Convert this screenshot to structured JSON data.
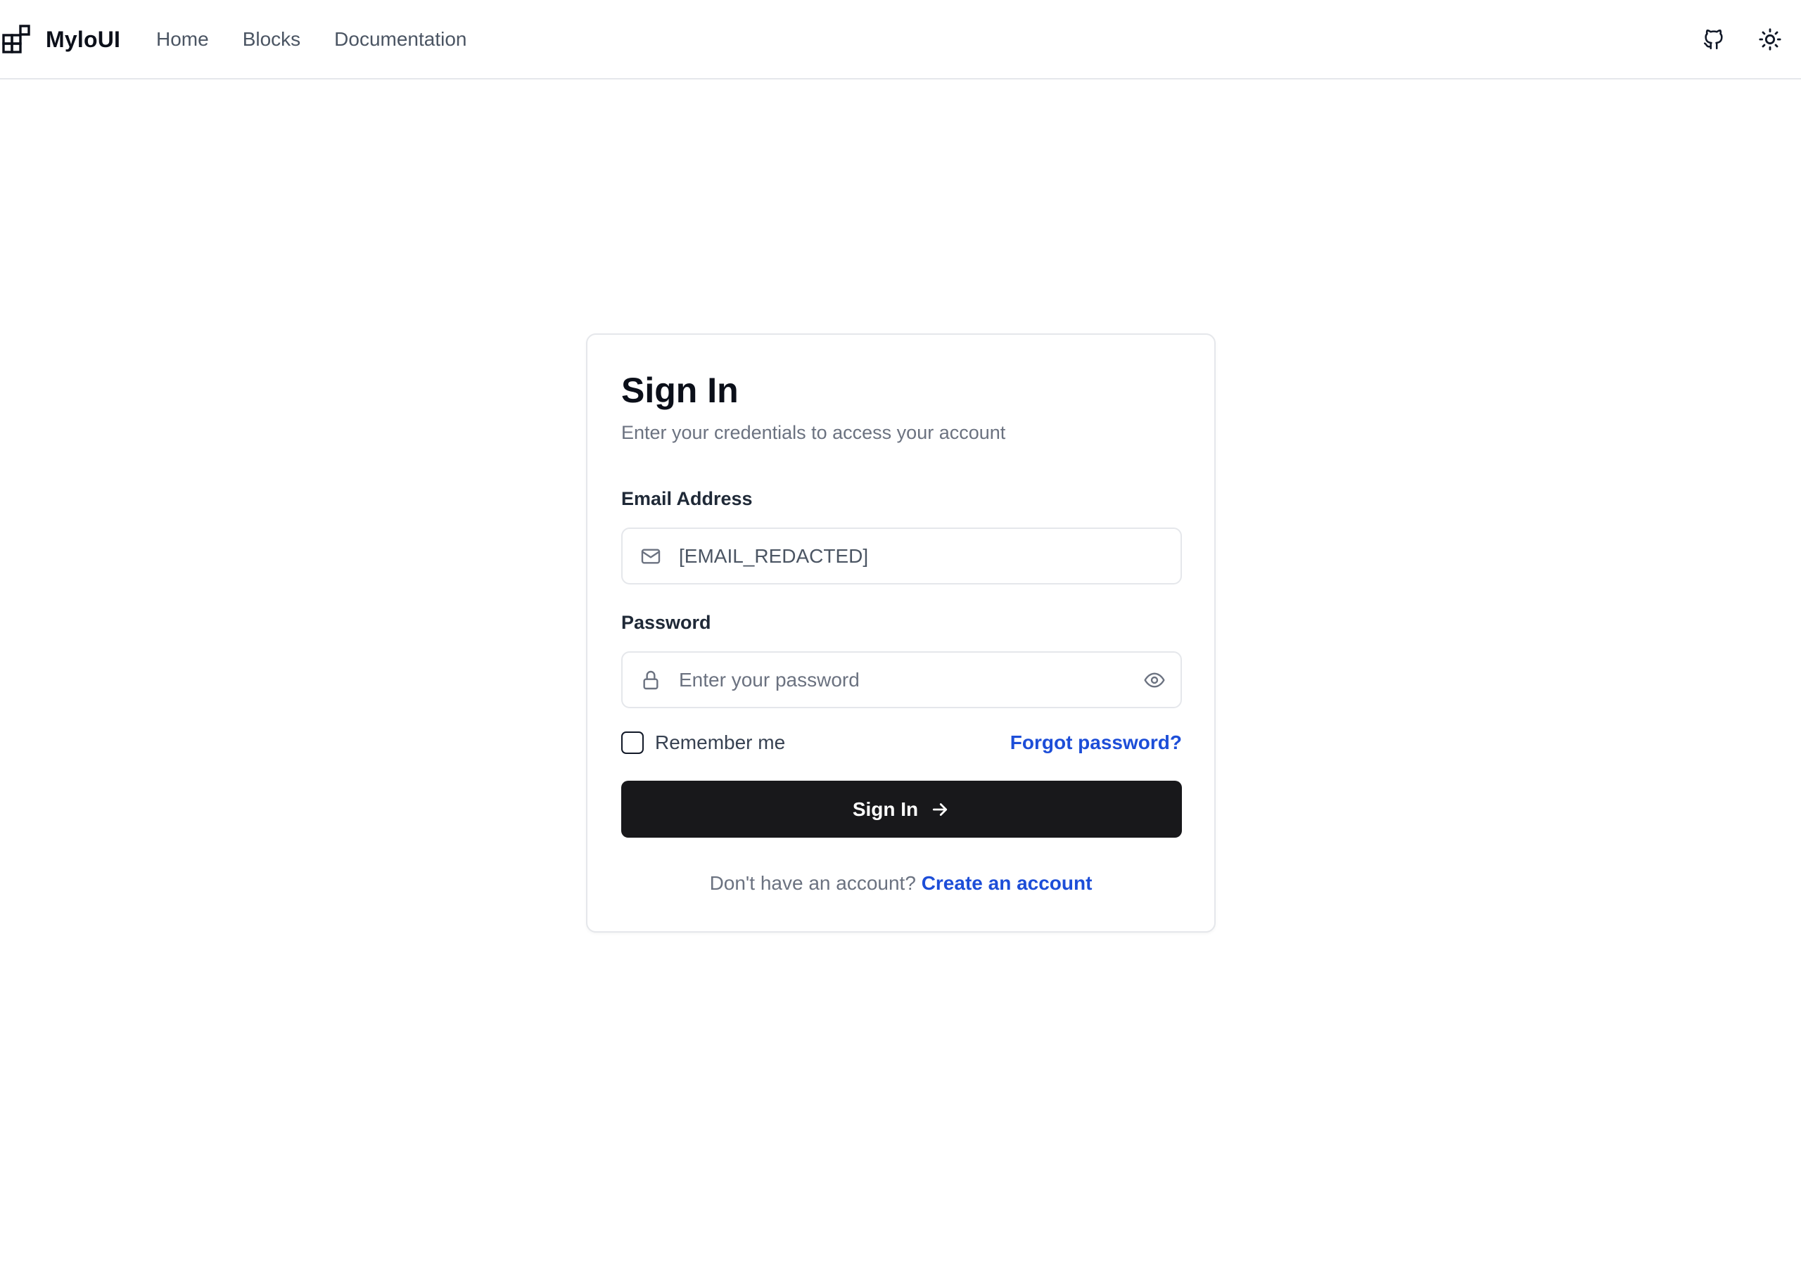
{
  "header": {
    "brand_name": "MyloUI",
    "brand_icon": "blocks-logo-icon",
    "nav": [
      {
        "label": "Home"
      },
      {
        "label": "Blocks"
      },
      {
        "label": "Documentation"
      }
    ],
    "actions": {
      "github_icon": "github-icon",
      "theme_icon": "sun-icon"
    }
  },
  "signin": {
    "title": "Sign In",
    "subtitle": "Enter your credentials to access your account",
    "email": {
      "label": "Email Address",
      "value": "[EMAIL_REDACTED]",
      "icon": "mail-icon"
    },
    "password": {
      "label": "Password",
      "placeholder": "Enter your password",
      "icon": "lock-icon",
      "toggle_icon": "eye-icon"
    },
    "remember_label": "Remember me",
    "remember_checked": false,
    "forgot_label": "Forgot password?",
    "submit_label": "Sign In",
    "submit_icon": "arrow-right-icon",
    "signup_prompt": "Don't have an account?",
    "signup_link": "Create an account"
  },
  "colors": {
    "primary_button": "#18181b",
    "link": "#1d4ed8",
    "border": "#e5e7eb",
    "muted_text": "#6b7280"
  }
}
